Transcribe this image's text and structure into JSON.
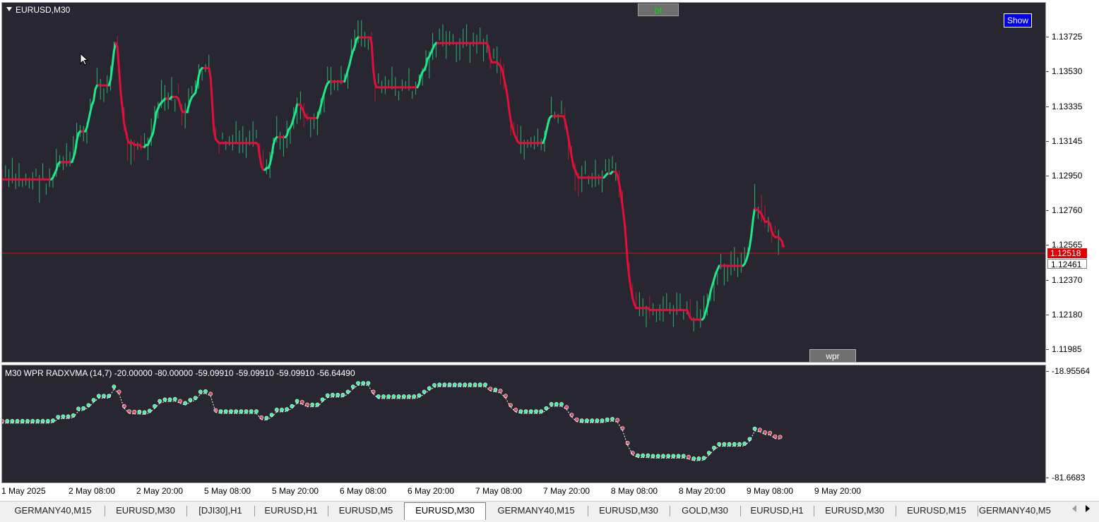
{
  "main_chart": {
    "title": "EURUSD,M30",
    "bt_label": "bt",
    "show_label": "Show",
    "wpr_label": "wpr",
    "colors": {
      "background": "#282630",
      "bull": "#1ee88a",
      "bear": "#e0103a",
      "current_price_line": "#c81414"
    }
  },
  "price_axis": {
    "labels": [
      "1.13725",
      "1.13530",
      "1.13335",
      "1.13145",
      "1.12950",
      "1.12760",
      "1.12565",
      "1.12370",
      "1.12180",
      "1.11985"
    ],
    "current_bid": "1.12518",
    "current_alt": "1.12461"
  },
  "sub_chart": {
    "title": "M30 WPR  RADXVMA (14,7) -20.00000 -80.00000 -59.09910 -59.09910 -59.09910 -56.64490",
    "scale_top": "-18.95564",
    "scale_bottom": "-81.6683"
  },
  "time_axis": {
    "labels": [
      "1 May 2025",
      "2 May 08:00",
      "2 May 20:00",
      "5 May 08:00",
      "5 May 20:00",
      "6 May 08:00",
      "6 May 20:00",
      "7 May 08:00",
      "7 May 20:00",
      "8 May 08:00",
      "8 May 20:00",
      "9 May 08:00",
      "9 May 20:00"
    ]
  },
  "tabs": {
    "items": [
      "GERMANY40,M15",
      "EURUSD,M30",
      "[DJI30],H1",
      "EURUSD,H1",
      "EURUSD,M5",
      "EURUSD,M30",
      "GERMANY40,M15",
      "EURUSD,M30",
      "GOLD,M30",
      "EURUSD,H1",
      "EURUSD,M30",
      "EURUSD,M15",
      "GERMANY40,M5"
    ],
    "active_index": 5
  },
  "chart_data": {
    "type": "line",
    "title": "EURUSD,M30",
    "ylim": [
      1.1196,
      1.1383
    ],
    "series": [
      {
        "name": "",
        "y": [
          1.1291,
          1.1291,
          1.1291,
          1.1291,
          1.1291,
          1.1291,
          1.1291,
          1.1291,
          1.1291,
          1.1291,
          1.1291,
          1.1291,
          1.1291,
          1.1291,
          1.1291,
          1.1291,
          1.1291,
          1.1291,
          1.1291,
          1.1291,
          1.1291,
          1.1291,
          1.1291,
          1.1291,
          1.1291,
          1.1291,
          1.1291,
          1.1291,
          1.1291,
          1.1291,
          1.1292,
          1.1294,
          1.1296,
          1.1299,
          1.13,
          1.13,
          1.13,
          1.13,
          1.13,
          1.13,
          1.13,
          1.13,
          1.1302,
          1.1305,
          1.1311,
          1.1315,
          1.1316,
          1.1316,
          1.1316,
          1.1316,
          1.1318,
          1.1322,
          1.1326,
          1.133,
          1.1332,
          1.1338,
          1.134,
          1.134,
          1.134,
          1.134,
          1.134,
          1.134,
          1.134,
          1.134,
          1.1343,
          1.135,
          1.1358,
          1.1362,
          1.136,
          1.1348,
          1.1336,
          1.1328,
          1.132,
          1.1316,
          1.1312,
          1.131,
          1.131,
          1.131,
          1.1309,
          1.1309,
          1.1309,
          1.1309,
          1.1308,
          1.1308,
          1.1308,
          1.1309,
          1.1309,
          1.1311,
          1.1313,
          1.1315,
          1.132,
          1.1326,
          1.1328,
          1.133,
          1.1331,
          1.1332,
          1.1333,
          1.1333,
          1.1333,
          1.1333,
          1.1334,
          1.1334,
          1.1334,
          1.1334,
          1.1333,
          1.133,
          1.1327,
          1.1326,
          1.1326,
          1.1326,
          1.1329,
          1.1332,
          1.1334,
          1.1335,
          1.1336,
          1.134,
          1.1345,
          1.1348,
          1.1349,
          1.1349,
          1.1349,
          1.1349,
          1.1349,
          1.1344,
          1.133,
          1.1316,
          1.1312,
          1.1311,
          1.131,
          1.131,
          1.131,
          1.131,
          1.131,
          1.131,
          1.131,
          1.131,
          1.131,
          1.131,
          1.131,
          1.131,
          1.131,
          1.131,
          1.131,
          1.131,
          1.131,
          1.131,
          1.131,
          1.131,
          1.131,
          1.131,
          1.131,
          1.1309,
          1.1303,
          1.1298,
          1.1296,
          1.1296,
          1.1297,
          1.1297,
          1.1299,
          1.1303,
          1.1309,
          1.1312,
          1.1313,
          1.1313,
          1.1313,
          1.1313,
          1.1313,
          1.1313,
          1.1314,
          1.1317,
          1.1318,
          1.132,
          1.1323,
          1.1326,
          1.133,
          1.133,
          1.133,
          1.1328,
          1.1326,
          1.1324,
          1.1323,
          1.1323,
          1.1323,
          1.1323,
          1.1323,
          1.1323,
          1.1323,
          1.1326,
          1.1329,
          1.1333,
          1.1336,
          1.1339,
          1.1341,
          1.1342,
          1.1342,
          1.1342,
          1.1342,
          1.1342,
          1.1342,
          1.1342,
          1.1342,
          1.1342,
          1.1342,
          1.1345,
          1.1348,
          1.1351,
          1.1355,
          1.1358,
          1.136,
          1.1364,
          1.1365,
          1.1365,
          1.1365,
          1.1365,
          1.1365,
          1.1365,
          1.1365,
          1.1365,
          1.1362,
          1.1348,
          1.1341,
          1.1339,
          1.1339,
          1.1339,
          1.1339,
          1.1339,
          1.1339,
          1.1339,
          1.1339,
          1.1339,
          1.1339,
          1.1339,
          1.1339,
          1.1339,
          1.1339,
          1.1339,
          1.1339,
          1.1339,
          1.1339,
          1.1339,
          1.1339,
          1.1339,
          1.1339,
          1.1339,
          1.1339,
          1.1339,
          1.1341,
          1.1345,
          1.1347,
          1.1348,
          1.135,
          1.1354,
          1.1355,
          1.1357,
          1.1359,
          1.1361,
          1.1362,
          1.1362,
          1.1362,
          1.1362,
          1.1362,
          1.1362,
          1.1362,
          1.1362,
          1.1362,
          1.1362,
          1.1362,
          1.1362,
          1.1362,
          1.1362,
          1.1362,
          1.1362,
          1.1362,
          1.1362,
          1.1362,
          1.1362,
          1.1362,
          1.1362,
          1.1362,
          1.1362,
          1.1362,
          1.1362,
          1.1362,
          1.1362,
          1.1362,
          1.1362,
          1.1362,
          1.136,
          1.1354,
          1.1352,
          1.1352,
          1.1352,
          1.1352,
          1.1351,
          1.135,
          1.1348,
          1.1344,
          1.134,
          1.1335,
          1.1328,
          1.1322,
          1.1318,
          1.1315,
          1.1313,
          1.1311,
          1.131,
          1.131,
          1.131,
          1.131,
          1.131,
          1.131,
          1.131,
          1.131,
          1.131,
          1.131,
          1.131,
          1.131,
          1.131,
          1.131,
          1.131,
          1.1312,
          1.1316,
          1.132,
          1.1323,
          1.1324,
          1.1324,
          1.1324,
          1.1324,
          1.1324,
          1.1324,
          1.1324,
          1.1324,
          1.1322,
          1.1318,
          1.1313,
          1.1308,
          1.1303,
          1.1298,
          1.1296,
          1.1294,
          1.1292,
          1.1292,
          1.1292,
          1.1292,
          1.1292,
          1.1292,
          1.1292,
          1.1292,
          1.1292,
          1.1292,
          1.1292,
          1.1292,
          1.1292,
          1.1292,
          1.1292,
          1.1292,
          1.1293,
          1.1294,
          1.1294,
          1.1294,
          1.1295,
          1.1295,
          1.1295,
          1.1293,
          1.1289,
          1.1284,
          1.1277,
          1.127,
          1.126,
          1.1248,
          1.124,
          1.1234,
          1.1229,
          1.1226,
          1.1224,
          1.1224,
          1.1224,
          1.1224,
          1.1224,
          1.1224,
          1.1224,
          1.1224,
          1.1223,
          1.1223,
          1.1223,
          1.1223,
          1.1223,
          1.1223,
          1.1223,
          1.1223,
          1.1223,
          1.1223,
          1.1223,
          1.1223,
          1.1223,
          1.1223,
          1.1223,
          1.1223,
          1.1223,
          1.1223,
          1.1223,
          1.1223,
          1.1223,
          1.1223,
          1.1223,
          1.1221,
          1.1219,
          1.1218,
          1.1218,
          1.1218,
          1.1218,
          1.1218,
          1.1218,
          1.1218,
          1.1219,
          1.1222,
          1.1225,
          1.1229,
          1.1233,
          1.1236,
          1.1239,
          1.1242,
          1.1244,
          1.1246,
          1.1246,
          1.1246,
          1.1246,
          1.1246,
          1.1246,
          1.1246,
          1.1246,
          1.1246,
          1.1246,
          1.1246,
          1.1246,
          1.1246,
          1.1246,
          1.1246,
          1.1247,
          1.1249,
          1.1252,
          1.1256,
          1.1262,
          1.127,
          1.1276,
          1.1275,
          1.1275,
          1.1274,
          1.1273,
          1.1271,
          1.1269,
          1.1269,
          1.1269,
          1.1268,
          1.1264,
          1.1262,
          1.1261,
          1.1261,
          1.1261,
          1.126,
          1.1259,
          1.1256
        ]
      }
    ]
  }
}
